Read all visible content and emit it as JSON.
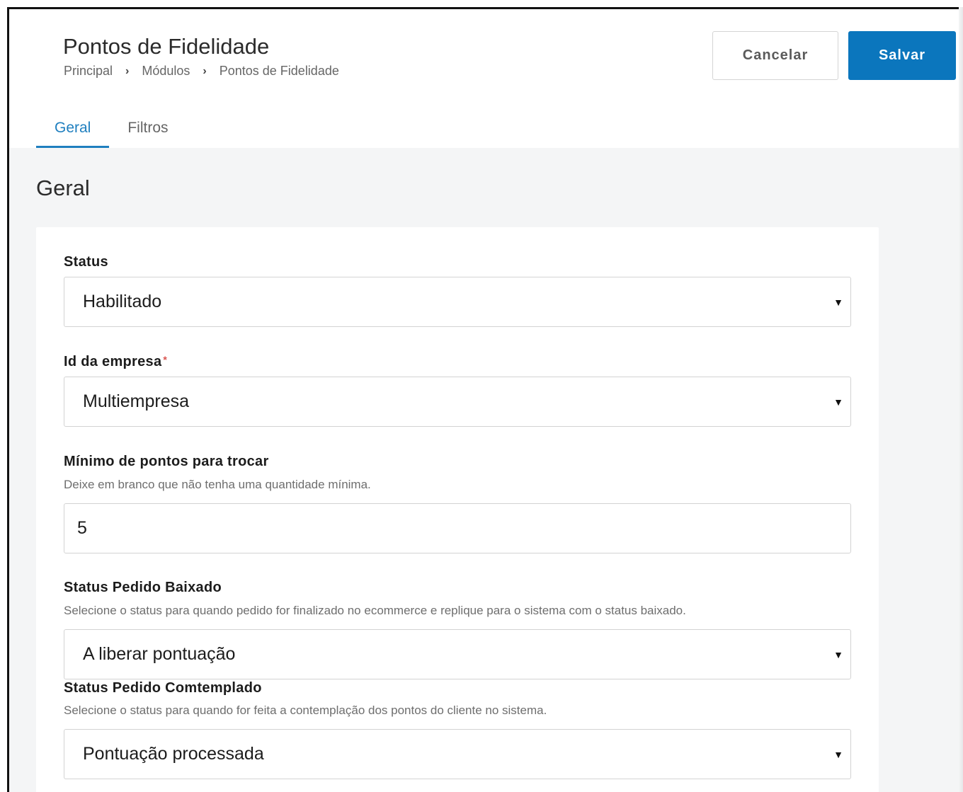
{
  "header": {
    "title": "Pontos de Fidelidade",
    "breadcrumb": [
      "Principal",
      "Módulos",
      "Pontos de Fidelidade"
    ],
    "cancel_label": "Cancelar",
    "save_label": "Salvar"
  },
  "tabs": [
    {
      "label": "Geral",
      "active": true
    },
    {
      "label": "Filtros",
      "active": false
    }
  ],
  "section": {
    "title": "Geral"
  },
  "form": {
    "status": {
      "label": "Status",
      "value": "Habilitado"
    },
    "company": {
      "label": "Id da empresa",
      "required_mark": "*",
      "value": "Multiempresa"
    },
    "min_points": {
      "label": "Mínimo de pontos para trocar",
      "help": "Deixe em branco que não tenha uma quantidade mínima.",
      "value": "5"
    },
    "order_status_closed": {
      "label": "Status Pedido Baixado",
      "help": "Selecione o status para quando pedido for finalizado no ecommerce e replique para o sistema com o status baixado.",
      "value": "A liberar pontuação"
    },
    "order_status_contemplated": {
      "label": "Status Pedido Comtemplado",
      "help": "Selecione o status para quando for feita a contemplação dos pontos do cliente no sistema.",
      "value": "Pontuação processada"
    }
  },
  "icons": {
    "breadcrumb_separator": "chevron-right-icon",
    "select_arrow": "caret-down-icon"
  },
  "colors": {
    "primary": "#0b76bd",
    "tab_active": "#1f7fbf",
    "required": "#d9534f",
    "content_bg": "#f4f5f6"
  }
}
